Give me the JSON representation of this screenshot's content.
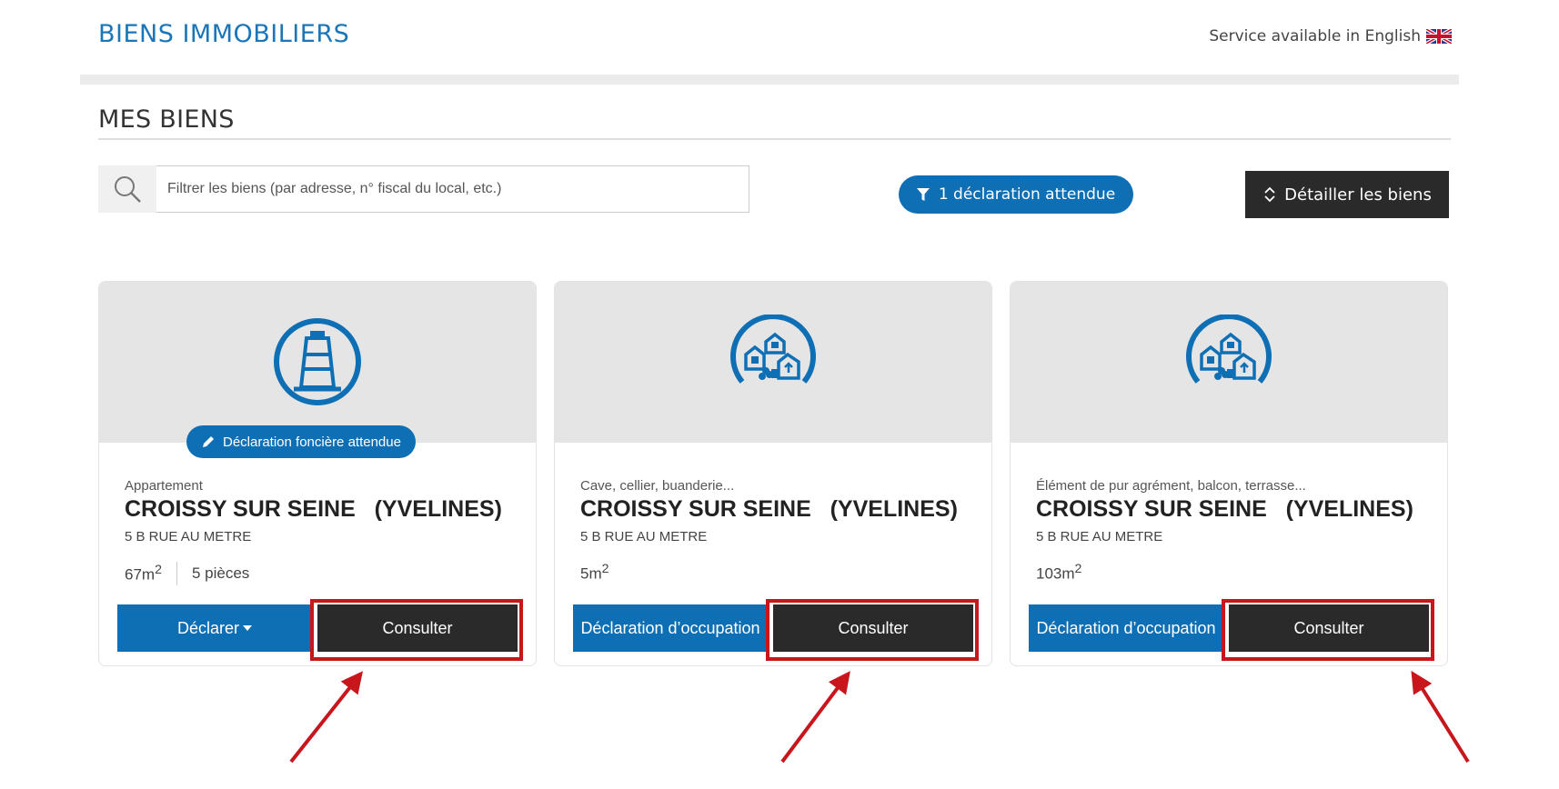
{
  "header": {
    "title": "BIENS IMMOBILIERS",
    "service_text": "Service available in English"
  },
  "section": {
    "title": "MES BIENS"
  },
  "search": {
    "placeholder": "Filtrer les biens (par adresse, n° fiscal du local, etc.)"
  },
  "filter": {
    "label": "1 déclaration attendue"
  },
  "detail_button": {
    "label": "Détailler les biens"
  },
  "cards": [
    {
      "badge": "Déclaration foncière attendue",
      "type": "Appartement",
      "city": "CROISSY SUR SEINE   (YVELINES)",
      "address": "5 B RUE AU METRE",
      "area": "67m",
      "rooms": "5 pièces",
      "left_button": "Déclarer",
      "right_button": "Consulter"
    },
    {
      "type": "Cave, cellier, buanderie...",
      "city": "CROISSY SUR SEINE   (YVELINES)",
      "address": "5 B RUE AU METRE",
      "area": "5m",
      "left_button": "Déclaration d’occupation",
      "right_button": "Consulter"
    },
    {
      "type": "Élément de pur agrément, balcon, terrasse...",
      "city": "CROISSY SUR SEINE   (YVELINES)",
      "address": "5 B RUE AU METRE",
      "area": "103m",
      "left_button": "Déclaration d’occupation",
      "right_button": "Consulter"
    }
  ],
  "colors": {
    "brand_blue": "#0f6fb5",
    "dark_button": "#2a2a2a",
    "highlight_red": "#c8161d"
  }
}
